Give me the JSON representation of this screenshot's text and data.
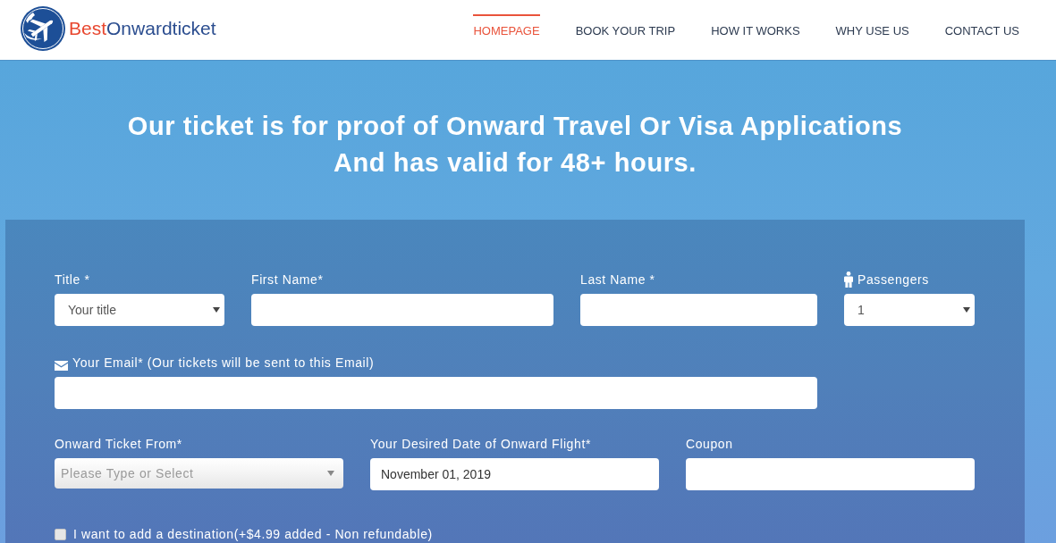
{
  "brand": [
    {
      "text": "Best",
      "color": "#e8472f"
    },
    {
      "text": "Onwardticket",
      "color": "#2b4d8f"
    }
  ],
  "nav": [
    {
      "label": "HOMEPAGE",
      "selected": true
    },
    {
      "label": "BOOK YOUR TRIP",
      "selected": false
    },
    {
      "label": "HOW IT WORKS",
      "selected": false
    },
    {
      "label": "WHY USE US",
      "selected": false
    },
    {
      "label": "CONTACT US",
      "selected": false
    }
  ],
  "hero": {
    "headline": [
      "Our ticket is for proof of Onward Travel Or Visa Applications",
      "And has valid for 48+ hours."
    ]
  },
  "form": {
    "title": {
      "label": "Title *",
      "value": "Your title"
    },
    "first_name": {
      "label": "First Name*"
    },
    "last_name": {
      "label": "Last Name *"
    },
    "passengers": {
      "label": "Passengers",
      "value": "1"
    },
    "email": {
      "label": "Your Email* (Our tickets will be sent to this Email)"
    },
    "onward_from": {
      "label": "Onward Ticket From*",
      "placeholder": "Please Type or Select"
    },
    "flight_date": {
      "label": "Your Desired Date of Onward Flight*",
      "value": "November 01, 2019"
    },
    "coupon": {
      "label": "Coupon"
    },
    "add_destination": {
      "label": "I want to add a destination(+$4.99 added - Non refundable)",
      "checked": false
    }
  }
}
